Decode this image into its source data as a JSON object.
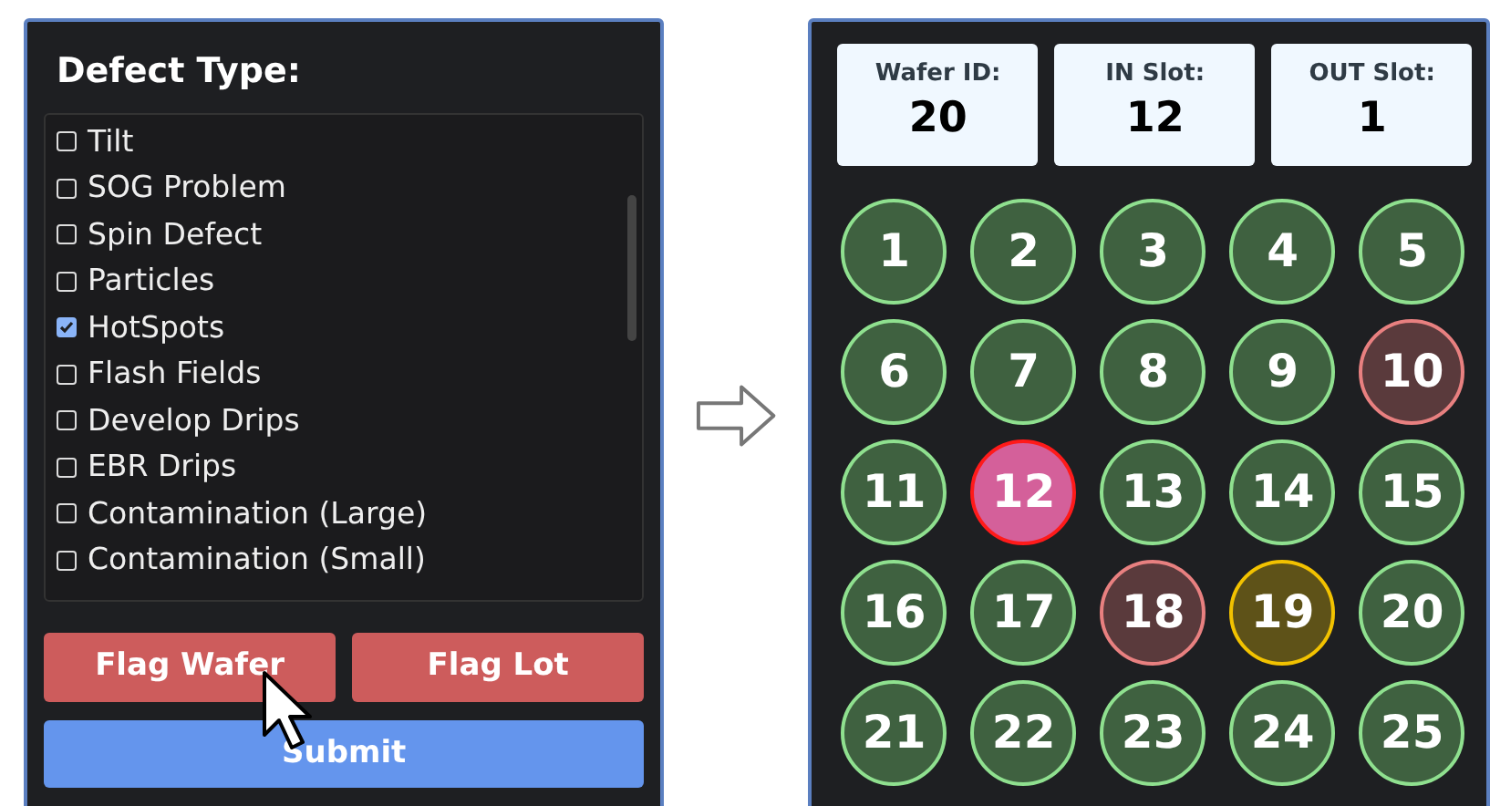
{
  "defect_panel": {
    "title": "Defect Type:",
    "items": [
      {
        "label": "Tilt",
        "checked": false
      },
      {
        "label": "SOG Problem",
        "checked": false
      },
      {
        "label": "Spin Defect",
        "checked": false
      },
      {
        "label": "Particles",
        "checked": false
      },
      {
        "label": "HotSpots",
        "checked": true
      },
      {
        "label": "Flash Fields",
        "checked": false
      },
      {
        "label": "Develop Drips",
        "checked": false
      },
      {
        "label": "EBR Drips",
        "checked": false
      },
      {
        "label": "Contamination (Large)",
        "checked": false
      },
      {
        "label": "Contamination (Small)",
        "checked": false
      }
    ],
    "buttons": [
      {
        "label": "Flag Wafer",
        "kind": "flag"
      },
      {
        "label": "Flag Lot",
        "kind": "flag"
      },
      {
        "label": "Submit",
        "kind": "submit"
      }
    ]
  },
  "wafer_panel": {
    "info": [
      {
        "label": "Wafer ID:",
        "value": "20"
      },
      {
        "label": "IN Slot:",
        "value": "12"
      },
      {
        "label": "OUT Slot:",
        "value": "1"
      }
    ],
    "slots": [
      {
        "label": "1",
        "kind": "ok"
      },
      {
        "label": "2",
        "kind": "ok"
      },
      {
        "label": "3",
        "kind": "ok"
      },
      {
        "label": "4",
        "kind": "ok"
      },
      {
        "label": "5",
        "kind": "ok"
      },
      {
        "label": "6",
        "kind": "ok"
      },
      {
        "label": "7",
        "kind": "ok"
      },
      {
        "label": "8",
        "kind": "ok"
      },
      {
        "label": "9",
        "kind": "ok"
      },
      {
        "label": "10",
        "kind": "flagged"
      },
      {
        "label": "11",
        "kind": "ok"
      },
      {
        "label": "12",
        "kind": "current"
      },
      {
        "label": "13",
        "kind": "ok"
      },
      {
        "label": "14",
        "kind": "ok"
      },
      {
        "label": "15",
        "kind": "ok"
      },
      {
        "label": "16",
        "kind": "ok"
      },
      {
        "label": "17",
        "kind": "ok"
      },
      {
        "label": "18",
        "kind": "flagged"
      },
      {
        "label": "19",
        "kind": "warning"
      },
      {
        "label": "20",
        "kind": "ok"
      },
      {
        "label": "21",
        "kind": "ok"
      },
      {
        "label": "22",
        "kind": "ok"
      },
      {
        "label": "23",
        "kind": "ok"
      },
      {
        "label": "24",
        "kind": "ok"
      },
      {
        "label": "25",
        "kind": "ok"
      }
    ]
  }
}
